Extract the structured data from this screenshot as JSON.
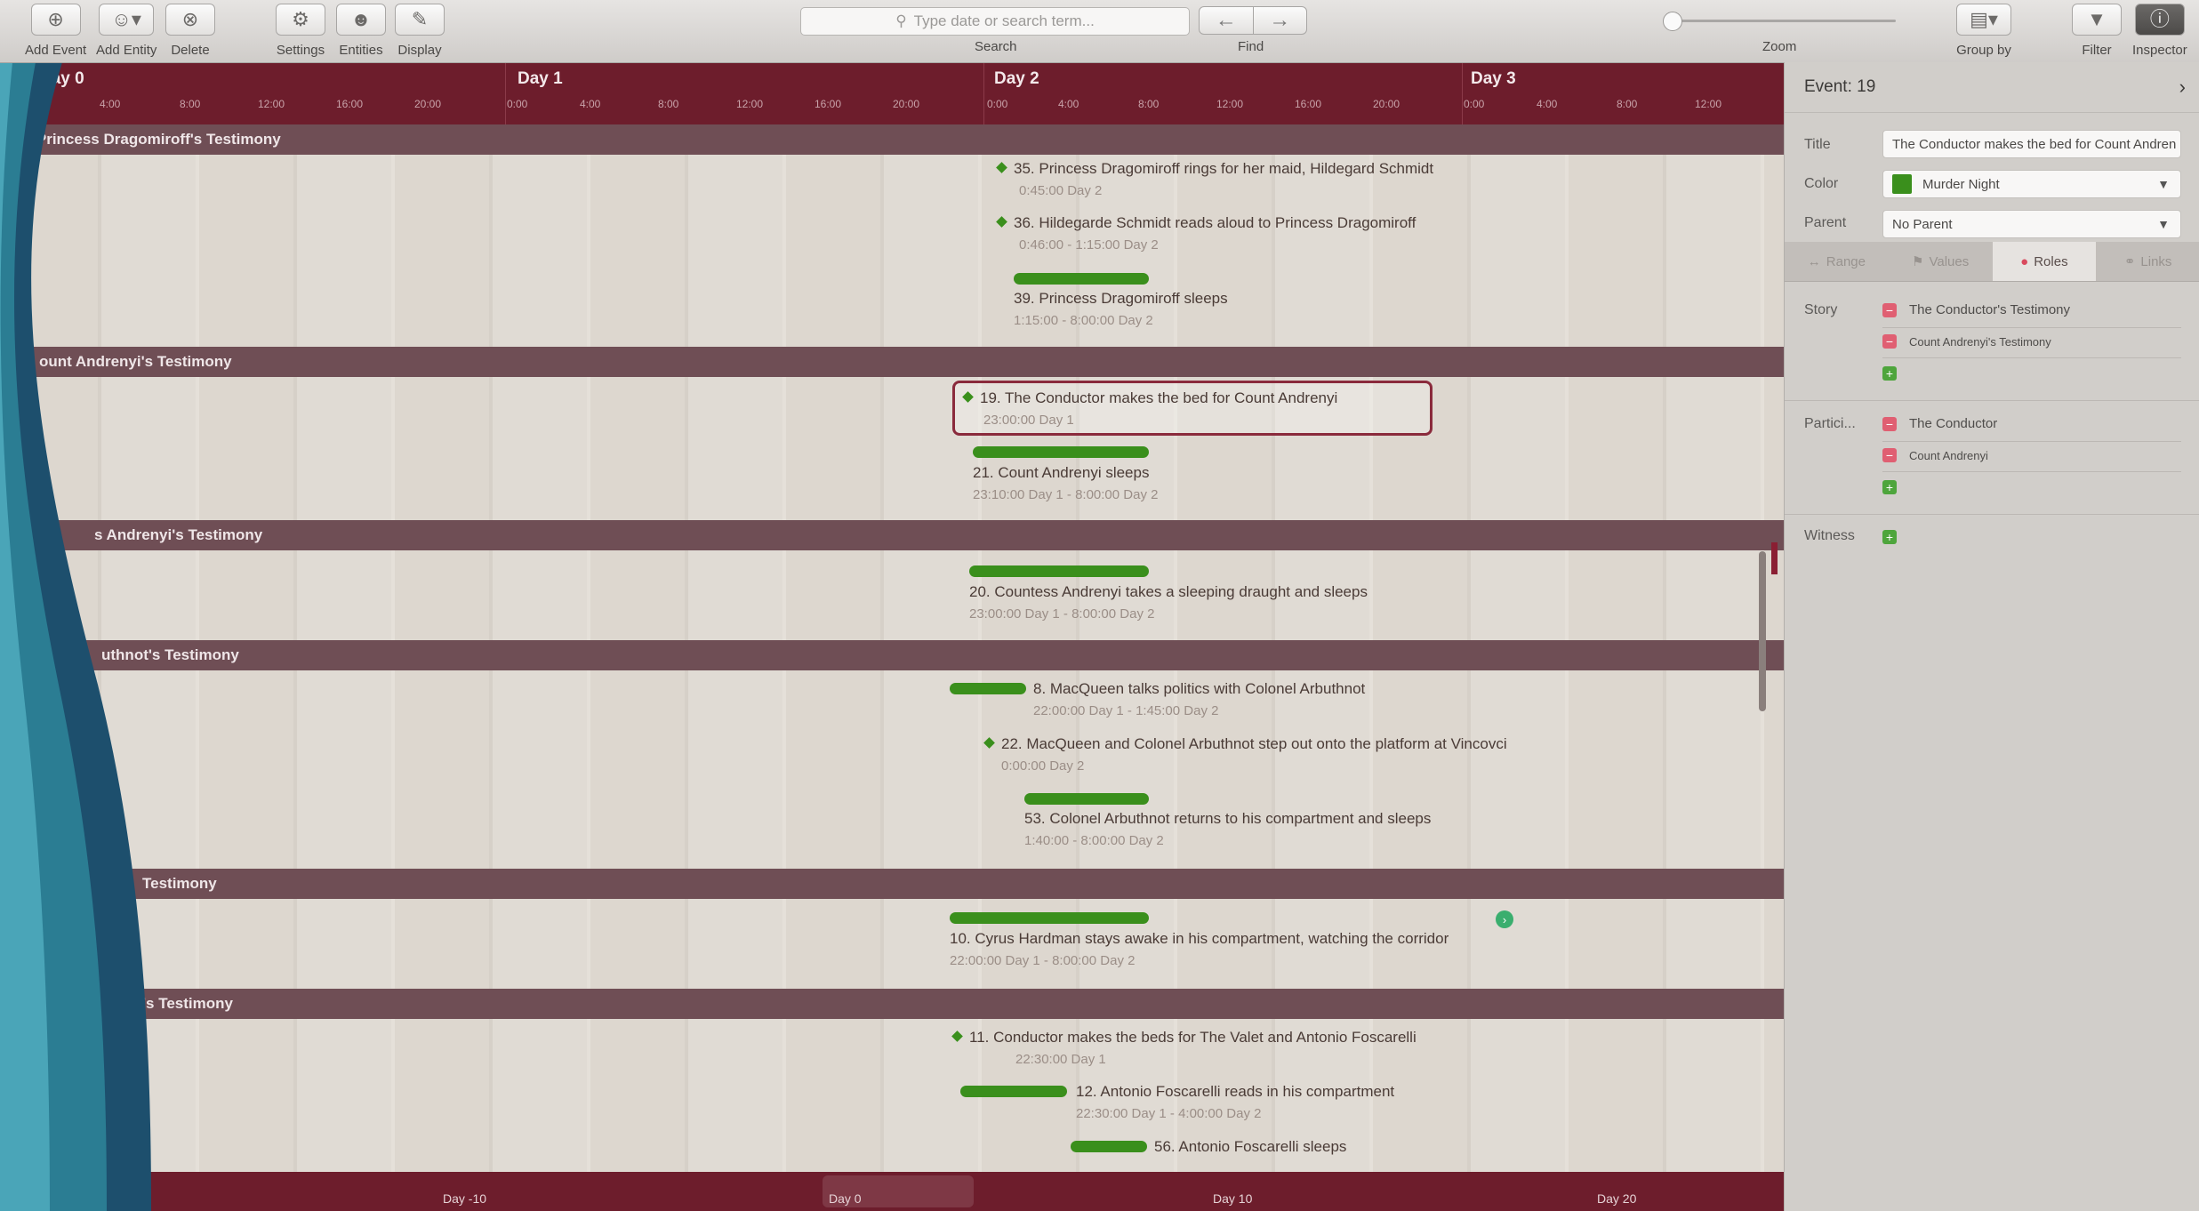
{
  "toolbar": {
    "add_event": "Add Event",
    "add_entity": "Add Entity",
    "delete": "Delete",
    "settings": "Settings",
    "entities": "Entities",
    "display": "Display",
    "search_label": "Search",
    "search_placeholder": "Type date or search term...",
    "find_label": "Find",
    "zoom_label": "Zoom",
    "group_by": "Group by",
    "filter": "Filter",
    "inspector": "Inspector"
  },
  "ruler": {
    "days": [
      "Day 0",
      "Day 1",
      "Day 2",
      "Day 3"
    ],
    "hours": [
      "0:00",
      "4:00",
      "8:00",
      "12:00",
      "16:00",
      "20:00"
    ]
  },
  "groups": [
    {
      "label": "Princess Dragomiroff's Testimony"
    },
    {
      "label": "ount Andrenyi's Testimony"
    },
    {
      "label": "s Andrenyi's Testimony"
    },
    {
      "label": "uthnot's Testimony"
    },
    {
      "label": "Testimony"
    },
    {
      "label": "'s Testimony"
    }
  ],
  "events": {
    "e35": {
      "title": "35. Princess Dragomiroff rings for her maid, Hildegard Schmidt",
      "time": "0:45:00 Day 2"
    },
    "e36": {
      "title": "36. Hildegarde Schmidt reads aloud to Princess Dragomiroff",
      "time": "0:46:00 - 1:15:00 Day 2"
    },
    "e39": {
      "title": "39. Princess Dragomiroff sleeps",
      "time": "1:15:00 - 8:00:00 Day 2"
    },
    "e19": {
      "title": "19. The Conductor makes the bed for Count Andrenyi",
      "time": "23:00:00 Day 1"
    },
    "e21": {
      "title": "21. Count Andrenyi sleeps",
      "time": "23:10:00 Day 1 - 8:00:00 Day 2"
    },
    "e20": {
      "title": "20. Countess Andrenyi takes a sleeping draught and sleeps",
      "time": "23:00:00 Day 1 - 8:00:00 Day 2"
    },
    "e8": {
      "title": "8. MacQueen talks politics with Colonel Arbuthnot",
      "time": "22:00:00 Day 1 - 1:45:00 Day 2"
    },
    "e22": {
      "title": "22. MacQueen and Colonel Arbuthnot step out onto the platform at Vincovci",
      "time": "0:00:00 Day 2"
    },
    "e53": {
      "title": "53. Colonel Arbuthnot returns to his compartment and sleeps",
      "time": "1:40:00 - 8:00:00 Day 2"
    },
    "e10": {
      "title": "10. Cyrus Hardman stays awake in his compartment, watching the corridor",
      "time": "22:00:00 Day 1 - 8:00:00 Day 2"
    },
    "e11": {
      "title": "11. Conductor makes the beds for The Valet and Antonio Foscarelli",
      "time": "22:30:00 Day 1"
    },
    "e12": {
      "title": "12. Antonio Foscarelli reads in his compartment",
      "time": "22:30:00 Day 1 - 4:00:00 Day 2"
    },
    "e56": {
      "title": "56. Antonio Foscarelli sleeps",
      "time": "4:00:00 - 8:00:00 Day 2"
    }
  },
  "minimap": {
    "labels": [
      "Day -10",
      "Day 0",
      "Day 10",
      "Day 20"
    ]
  },
  "inspector": {
    "header": "Event: 19",
    "title_label": "Title",
    "title_value": "The Conductor makes the bed for Count Andren",
    "color_label": "Color",
    "color_value": "Murder Night",
    "color_hex": "#3a8f1c",
    "parent_label": "Parent",
    "parent_value": "No Parent",
    "tabs": [
      "Range",
      "Values",
      "Roles",
      "Links"
    ],
    "active_tab": "Roles",
    "story_label": "Story",
    "story_items": [
      "The Conductor's Testimony",
      "Count Andrenyi's Testimony"
    ],
    "participants_label": "Partici...",
    "participant_items": [
      "The Conductor",
      "Count Andrenyi"
    ],
    "witness_label": "Witness"
  }
}
